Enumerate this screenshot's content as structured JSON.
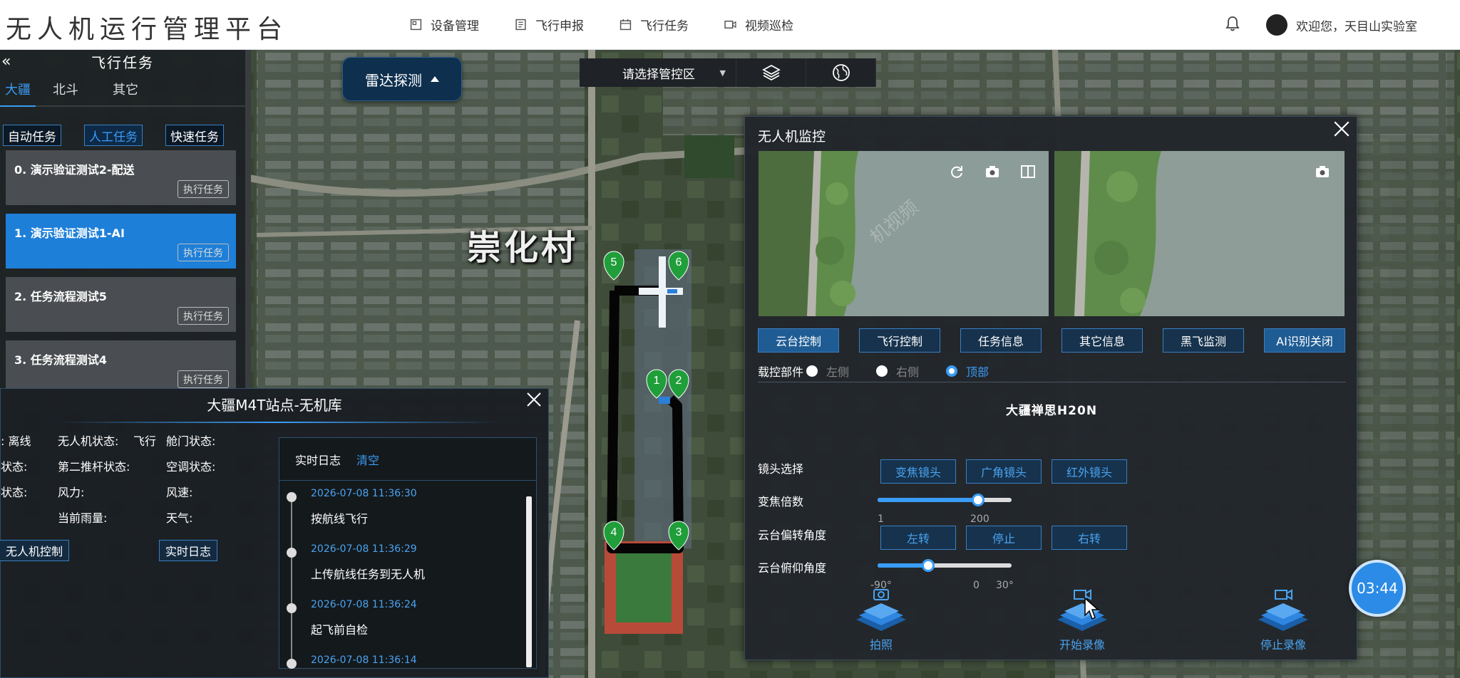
{
  "header": {
    "title": "无人机运行管理平台",
    "nav": [
      {
        "label": "设备管理",
        "icon": "device-icon"
      },
      {
        "label": "飞行申报",
        "icon": "document-icon"
      },
      {
        "label": "飞行任务",
        "icon": "calendar-icon"
      },
      {
        "label": "视频巡检",
        "icon": "video-icon"
      }
    ],
    "welcome": "欢迎您，天目山实验室"
  },
  "map": {
    "village_label": "崇化村",
    "radar_button": "雷达探测",
    "region_select": "请选择管控区",
    "waypoints": [
      "1",
      "2",
      "3",
      "4",
      "5",
      "6"
    ]
  },
  "task_panel": {
    "title": "飞行任务",
    "tabs": [
      "大疆",
      "北斗",
      "其它"
    ],
    "active_tab": "大疆",
    "modes": [
      "自动任务",
      "人工任务",
      "快速任务"
    ],
    "active_mode": "人工任务",
    "execute_label": "执行任务",
    "tasks": [
      {
        "name": "0. 演示验证测试2-配送",
        "active": false
      },
      {
        "name": "1. 演示验证测试1-AI",
        "active": true
      },
      {
        "name": "2. 任务流程测试5",
        "active": false
      },
      {
        "name": "3. 任务流程测试4",
        "active": false
      }
    ]
  },
  "station": {
    "title": "大疆M4T站点-无机库",
    "status": {
      "row1": [
        "离线",
        "无人机状态:",
        "飞行",
        "舱门状态:"
      ],
      "row2": [
        "状态:",
        "第二推杆状态:",
        "空调状态:"
      ],
      "row3": [
        "状态:",
        "风力:",
        "风速:"
      ],
      "row4": [
        "当前雨量:",
        "天气:"
      ]
    },
    "drone_control": "无人机控制",
    "realtime_log_btn": "实时日志",
    "log_tabs": {
      "log": "实时日志",
      "clear": "清空"
    },
    "logs": [
      {
        "time": "2026-07-08 11:36:30",
        "msg": "按航线飞行"
      },
      {
        "time": "2026-07-08 11:36:29",
        "msg": "上传航线任务到无人机"
      },
      {
        "time": "2026-07-08 11:36:24",
        "msg": "起飞前自检"
      },
      {
        "time": "2026-07-08 11:36:14",
        "msg": ""
      }
    ]
  },
  "monitor": {
    "title": "无人机监控",
    "watermark": "机视频",
    "func_buttons": [
      "云台控制",
      "飞行控制",
      "任务信息",
      "其它信息",
      "黑飞监测",
      "AI识别关闭"
    ],
    "payload_label": "载控部件",
    "payload_options": [
      "左侧",
      "右侧",
      "顶部"
    ],
    "payload_selected": "顶部",
    "camera_name": "大疆禅思H20N",
    "lens_label": "镜头选择",
    "lens_options": [
      "变焦镜头",
      "广角镜头",
      "红外镜头"
    ],
    "zoom_label": "变焦倍数",
    "zoom_min": "1",
    "zoom_max": "200",
    "zoom_level": 0.75,
    "yaw_label": "云台偏转角度",
    "yaw_buttons": [
      "左转",
      "停止",
      "右转"
    ],
    "pitch_label": "云台俯仰角度",
    "pitch_ticks": [
      "-90°",
      "0",
      "30°"
    ],
    "pitch_level": 0.38,
    "actions": [
      "拍照",
      "开始录像",
      "停止录像"
    ]
  },
  "timer": "03:44",
  "colors": {
    "accent": "#3a9cf5",
    "panel": "#1c2024",
    "active_task": "#1e7fd8"
  }
}
